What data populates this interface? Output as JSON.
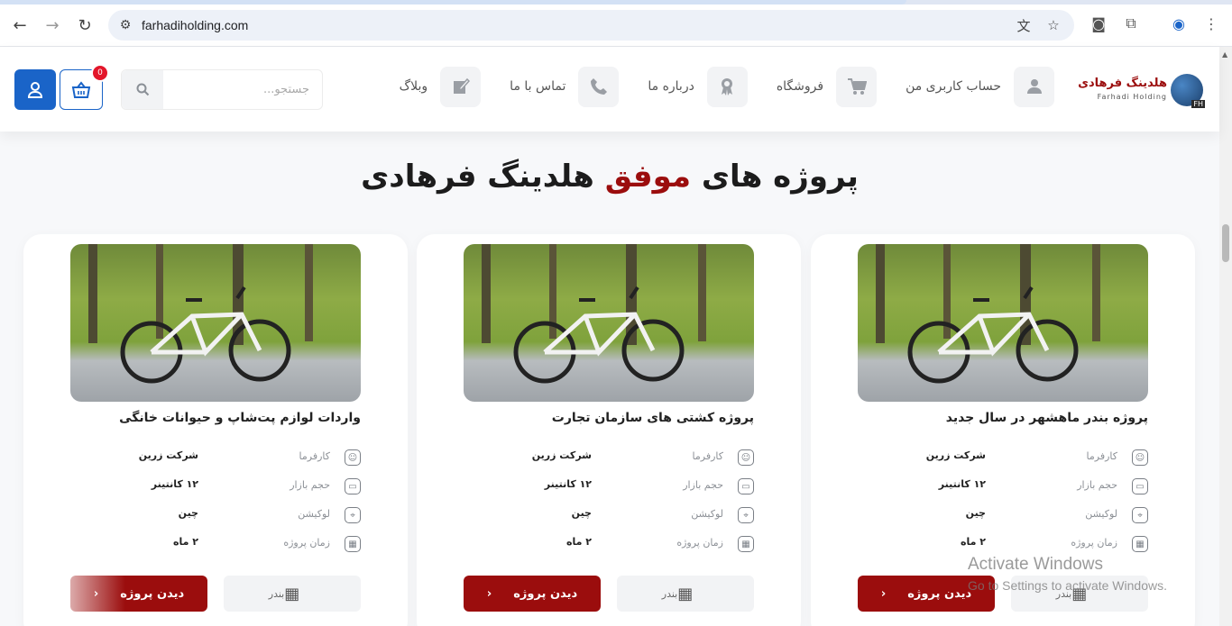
{
  "browser": {
    "url": "farhadiholding.com"
  },
  "logo": {
    "name": "هلدینگ فرهادی",
    "sub": "Farhadi Holding",
    "mark": "FH"
  },
  "menu": [
    {
      "label": "حساب کاربری من",
      "icon": "user-icon"
    },
    {
      "label": "فروشگاه",
      "icon": "cart-icon"
    },
    {
      "label": "درباره ما",
      "icon": "award-icon"
    },
    {
      "label": "تماس با ما",
      "icon": "phone-icon"
    },
    {
      "label": "وبلاگ",
      "icon": "edit-icon"
    }
  ],
  "search": {
    "placeholder": "جستجو..."
  },
  "cart": {
    "badge": "0"
  },
  "heading": {
    "part1": "پروژه های",
    "accent": "موفق",
    "part2": "هلدینگ فرهادی"
  },
  "cards": [
    {
      "title": "پروژه بندر ماهشهر در سال جدید",
      "rows": [
        {
          "label": "کارفرما",
          "value": "شرکت زرین"
        },
        {
          "label": "حجم بازار",
          "value": "۱۲ کانتینر"
        },
        {
          "label": "لوکیشن",
          "value": "چین"
        },
        {
          "label": "زمان پروژه",
          "value": "۲ ماه"
        }
      ],
      "view_label": "دیدن پروژه",
      "category": "بندر"
    },
    {
      "title": "پروژه کشتی های سازمان تجارت",
      "rows": [
        {
          "label": "کارفرما",
          "value": "شرکت زرین"
        },
        {
          "label": "حجم بازار",
          "value": "۱۲ کانتینر"
        },
        {
          "label": "لوکیشن",
          "value": "چین"
        },
        {
          "label": "زمان پروژه",
          "value": "۲ ماه"
        }
      ],
      "view_label": "دیدن پروژه",
      "category": "بندر"
    },
    {
      "title": "واردات لوازم پت‌شاپ و حیوانات خانگی",
      "rows": [
        {
          "label": "کارفرما",
          "value": "شرکت زرین"
        },
        {
          "label": "حجم بازار",
          "value": "۱۲ کانتینر"
        },
        {
          "label": "لوکیشن",
          "value": "چین"
        },
        {
          "label": "زمان پروژه",
          "value": "۲ ماه"
        }
      ],
      "view_label": "دیدن پروژه",
      "category": "بندر"
    }
  ],
  "watermark": {
    "line1": "Activate Windows",
    "line2": "Go to Settings to activate Windows."
  },
  "colors": {
    "accent": "#9b0d0d",
    "primary": "#1a64c8",
    "badge": "#e3162a"
  }
}
